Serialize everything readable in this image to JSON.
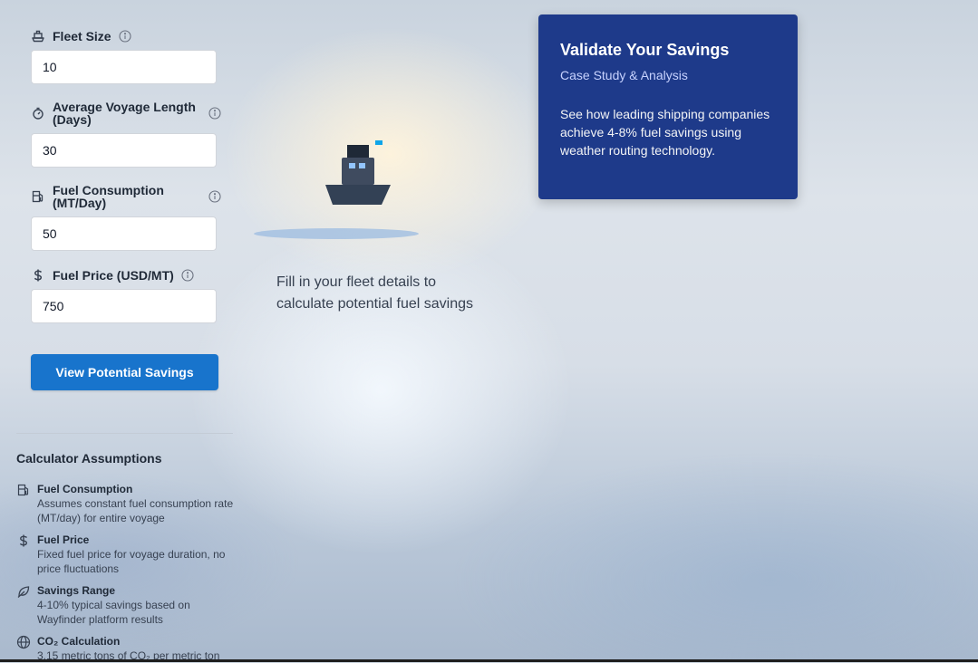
{
  "form": {
    "fleet_size": {
      "label": "Fleet Size",
      "value": "10",
      "icon": "ship-icon"
    },
    "voyage_length": {
      "label": "Average Voyage Length (Days)",
      "value": "30",
      "icon": "timer-icon"
    },
    "fuel_consumption": {
      "label": "Fuel Consumption (MT/Day)",
      "value": "50",
      "icon": "fuel-pump-icon"
    },
    "fuel_price": {
      "label": "Fuel Price (USD/MT)",
      "value": "750",
      "icon": "dollar-icon"
    },
    "submit_label": "View Potential Savings",
    "accent_color": "#1874cc"
  },
  "assumptions": {
    "title": "Calculator Assumptions",
    "items": [
      {
        "title": "Fuel Consumption",
        "desc": "Assumes constant fuel consumption rate (MT/day) for entire voyage",
        "icon": "fuel-pump-icon"
      },
      {
        "title": "Fuel Price",
        "desc": "Fixed fuel price for voyage duration, no price fluctuations",
        "icon": "dollar-icon"
      },
      {
        "title": "Savings Range",
        "desc": "4-10% typical savings based on Wayfinder platform results",
        "icon": "leaf-icon"
      },
      {
        "title": "CO₂ Calculation",
        "desc": "3.15 metric tons of CO₂ per metric ton",
        "icon": "globe-icon"
      }
    ]
  },
  "empty_state": {
    "message": "Fill in your fleet details to calculate potential fuel savings",
    "illustration": "ship-illustration"
  },
  "case_study": {
    "title": "Validate Your Savings",
    "subtitle": "Case Study & Analysis",
    "body": "See how leading shipping companies achieve 4-8% fuel savings using weather routing technology.",
    "background_color": "#1e3a8a"
  }
}
